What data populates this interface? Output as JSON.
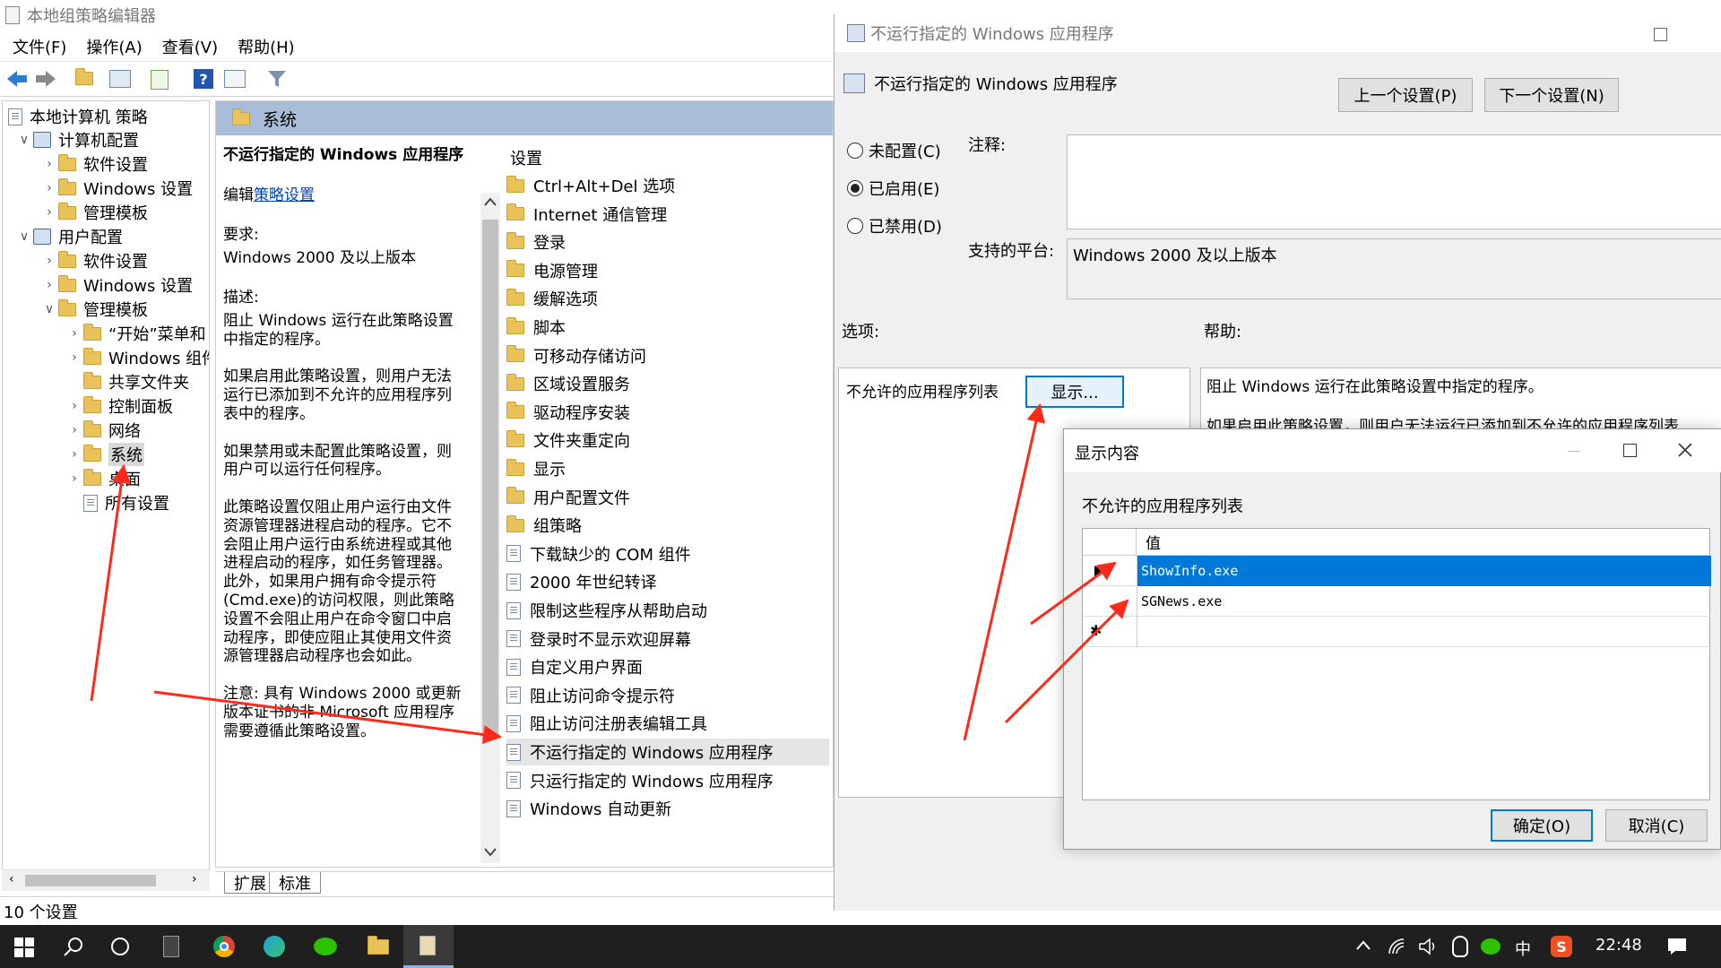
{
  "main_window": {
    "title": "本地组策略编辑器",
    "menu": [
      "文件(F)",
      "操作(A)",
      "查看(V)",
      "帮助(H)"
    ],
    "status": "10 个设置",
    "tabs": [
      "扩展",
      "标准"
    ]
  },
  "tree": {
    "root": "本地计算机 策略",
    "items": [
      {
        "label": "计算机配置",
        "level": 1,
        "expanded": true,
        "icon": "computer-icon"
      },
      {
        "label": "软件设置",
        "level": 2,
        "expanded": false,
        "icon": "folder-icon"
      },
      {
        "label": "Windows 设置",
        "level": 2,
        "expanded": false,
        "icon": "folder-icon"
      },
      {
        "label": "管理模板",
        "level": 2,
        "expanded": false,
        "icon": "folder-icon"
      },
      {
        "label": "用户配置",
        "level": 1,
        "expanded": true,
        "icon": "users-icon"
      },
      {
        "label": "软件设置",
        "level": 2,
        "expanded": false,
        "icon": "folder-icon"
      },
      {
        "label": "Windows 设置",
        "level": 2,
        "expanded": false,
        "icon": "folder-icon"
      },
      {
        "label": "管理模板",
        "level": 2,
        "expanded": true,
        "icon": "folder-icon"
      },
      {
        "label": "“开始”菜单和",
        "level": 3,
        "expanded": false,
        "icon": "folder-icon"
      },
      {
        "label": "Windows 组件",
        "level": 3,
        "expanded": false,
        "icon": "folder-icon"
      },
      {
        "label": "共享文件夹",
        "level": 3,
        "expanded": null,
        "icon": "folder-icon"
      },
      {
        "label": "控制面板",
        "level": 3,
        "expanded": false,
        "icon": "folder-icon"
      },
      {
        "label": "网络",
        "level": 3,
        "expanded": false,
        "icon": "folder-icon"
      },
      {
        "label": "系统",
        "level": 3,
        "expanded": false,
        "icon": "folder-icon",
        "selected": true
      },
      {
        "label": "桌面",
        "level": 3,
        "expanded": false,
        "icon": "folder-icon"
      },
      {
        "label": "所有设置",
        "level": 3,
        "expanded": null,
        "icon": "settings-doc-icon"
      }
    ]
  },
  "center": {
    "header": "系统",
    "desc_title": "不运行指定的 Windows 应用程序",
    "edit_prefix": "编辑",
    "edit_link": "策略设置",
    "requirements_label": "要求:",
    "requirements_value": "Windows 2000 及以上版本",
    "description_label": "描述:",
    "description_lines": [
      "阻止 Windows 运行在此策略设置",
      "中指定的程序。",
      "",
      "如果启用此策略设置，则用户无法",
      "运行已添加到不允许的应用程序列",
      "表中的程序。",
      "",
      "如果禁用或未配置此策略设置，则",
      "用户可以运行任何程序。",
      "",
      "此策略设置仅阻止用户运行由文件",
      "资源管理器进程启动的程序。它不",
      "会阻止用户运行由系统进程或其他",
      "进程启动的程序，如任务管理器。",
      "此外，如果用户拥有命令提示符",
      "(Cmd.exe)的访问权限，则此策略",
      "设置不会阻止用户在命令窗口中启",
      "动程序，即使应阻止其使用文件资",
      "源管理器启动程序也会如此。",
      "",
      "注意: 具有 Windows 2000 或更新",
      "版本证书的非 Microsoft 应用程序",
      "需要遵循此策略设置。"
    ],
    "list_header": "设置",
    "list_items": [
      {
        "label": "Ctrl+Alt+Del 选项",
        "icon": "folder-icon"
      },
      {
        "label": "Internet 通信管理",
        "icon": "folder-icon"
      },
      {
        "label": "登录",
        "icon": "folder-icon"
      },
      {
        "label": "电源管理",
        "icon": "folder-icon"
      },
      {
        "label": "缓解选项",
        "icon": "folder-icon"
      },
      {
        "label": "脚本",
        "icon": "folder-icon"
      },
      {
        "label": "可移动存储访问",
        "icon": "folder-icon"
      },
      {
        "label": "区域设置服务",
        "icon": "folder-icon"
      },
      {
        "label": "驱动程序安装",
        "icon": "folder-icon"
      },
      {
        "label": "文件夹重定向",
        "icon": "folder-icon"
      },
      {
        "label": "显示",
        "icon": "folder-icon"
      },
      {
        "label": "用户配置文件",
        "icon": "folder-icon"
      },
      {
        "label": "组策略",
        "icon": "folder-icon"
      },
      {
        "label": "下载缺少的 COM 组件",
        "icon": "policy-icon"
      },
      {
        "label": "2000 年世纪转译",
        "icon": "policy-icon"
      },
      {
        "label": "限制这些程序从帮助启动",
        "icon": "policy-icon"
      },
      {
        "label": "登录时不显示欢迎屏幕",
        "icon": "policy-icon"
      },
      {
        "label": "自定义用户界面",
        "icon": "policy-icon"
      },
      {
        "label": "阻止访问命令提示符",
        "icon": "policy-icon"
      },
      {
        "label": "阻止访问注册表编辑工具",
        "icon": "policy-icon"
      },
      {
        "label": "不运行指定的 Windows 应用程序",
        "icon": "policy-icon",
        "selected": true
      },
      {
        "label": "只运行指定的 Windows 应用程序",
        "icon": "policy-icon"
      },
      {
        "label": "Windows 自动更新",
        "icon": "policy-icon"
      }
    ]
  },
  "policy_window": {
    "title": "不运行指定的 Windows 应用程序",
    "heading": "不运行指定的 Windows 应用程序",
    "prev_button": "上一个设置(P)",
    "next_button": "下一个设置(N)",
    "radio_not_configured": "未配置(C)",
    "radio_enabled": "已启用(E)",
    "radio_disabled": "已禁用(D)",
    "comment_label": "注释:",
    "platform_label": "支持的平台:",
    "platform_value": "Windows 2000 及以上版本",
    "options_label": "选项:",
    "help_label": "帮助:",
    "option_list_label": "不允许的应用程序列表",
    "show_button": "显示...",
    "help_line1": "阻止 Windows 运行在此策略设置中指定的程序。",
    "help_line2": "如果启用此策略设置，则用户无法运行已添加到不允许的应用程序列表"
  },
  "show_dialog": {
    "title": "显示内容",
    "caption": "不允许的应用程序列表",
    "column_header": "值",
    "rows": [
      "ShowInfo.exe",
      "SGNews.exe",
      ""
    ],
    "ok_button": "确定(O)",
    "cancel_button": "取消(C)"
  },
  "taskbar": {
    "time": "22:48",
    "ime": "中",
    "apps": [
      "start-icon",
      "search-icon",
      "cortana-icon",
      "calculator-icon",
      "chrome-icon",
      "edge-dev-icon",
      "wechat-icon",
      "explorer-icon",
      "gpedit-icon"
    ]
  },
  "colors": {
    "selection": "#0078d7",
    "annotation_arrow": "#ff2a1a",
    "header_blue": "#a8bed8",
    "taskbar": "#1f1f1f"
  }
}
